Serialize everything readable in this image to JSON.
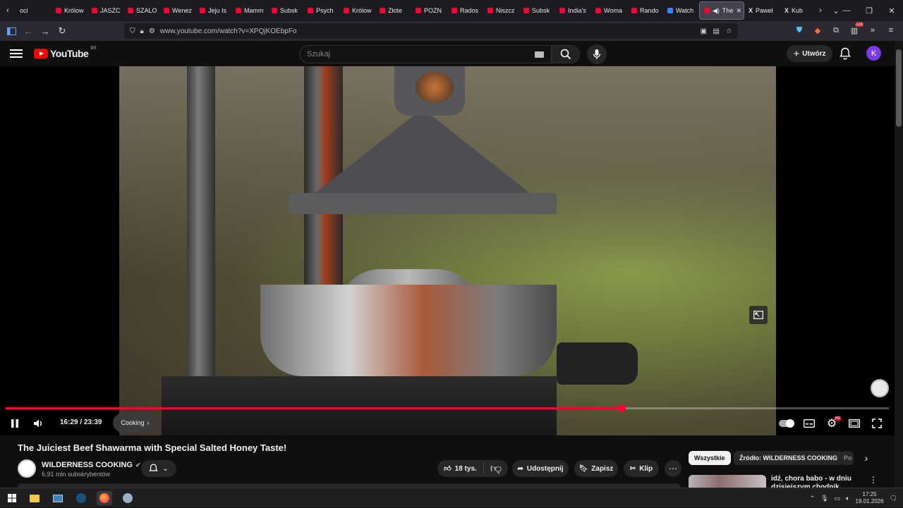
{
  "browser": {
    "tabs": [
      {
        "label": "oci"
      },
      {
        "label": "Królow"
      },
      {
        "label": "JASZC"
      },
      {
        "label": "SZALO"
      },
      {
        "label": "Wenez"
      },
      {
        "label": "Jeju Is"
      },
      {
        "label": "Mamm"
      },
      {
        "label": "Subsk"
      },
      {
        "label": "Psych"
      },
      {
        "label": "Królow"
      },
      {
        "label": "Złote"
      },
      {
        "label": "POZN"
      },
      {
        "label": "Rados"
      },
      {
        "label": "Niszcz"
      },
      {
        "label": "Subsk"
      },
      {
        "label": "India's"
      },
      {
        "label": "Woma"
      },
      {
        "label": "Rando"
      },
      {
        "label": "Watch"
      }
    ],
    "active_tab": {
      "label": "The"
    },
    "trailing_tabs": [
      {
        "label": "Paweł"
      },
      {
        "label": "Kub"
      }
    ],
    "url": "www.youtube.com/watch?v=XPQjKOEbpFo",
    "extension_badge": "118"
  },
  "youtube": {
    "logo_text": "YouTube",
    "country_code": "BR",
    "search_placeholder": "Szukaj",
    "create_label": "Utwórz",
    "avatar_letter": "K"
  },
  "player": {
    "time_current": "16:29",
    "time_total": "23:39",
    "time_display": "16:29 / 23:39",
    "chapter_label": "Cooking",
    "progress_fraction": 0.697,
    "settings_badge": "HD"
  },
  "video": {
    "title": "The Juiciest Beef Shawarma with Special Salted Honey Taste!",
    "channel_name": "WILDERNESS COOKING",
    "subscribers": "6,91 mln subskrybentów",
    "likes": "18 tys.",
    "share_label": "Udostępnij",
    "save_label": "Zapisz",
    "clip_label": "Klip"
  },
  "filters": {
    "chips": [
      "Wszystkie",
      "Źródło: WILDERNESS COOKING",
      "Po"
    ]
  },
  "recommendation": {
    "title": "idź, chora babo - w dniu dzisiejszym chodnik pieszym"
  },
  "taskbar": {
    "time": "17:25",
    "date": "19.01.2026"
  },
  "colors": {
    "accent": "#ff0033",
    "background": "#0f0f0f",
    "surface": "#272727",
    "avatar": "#7c3aed"
  }
}
